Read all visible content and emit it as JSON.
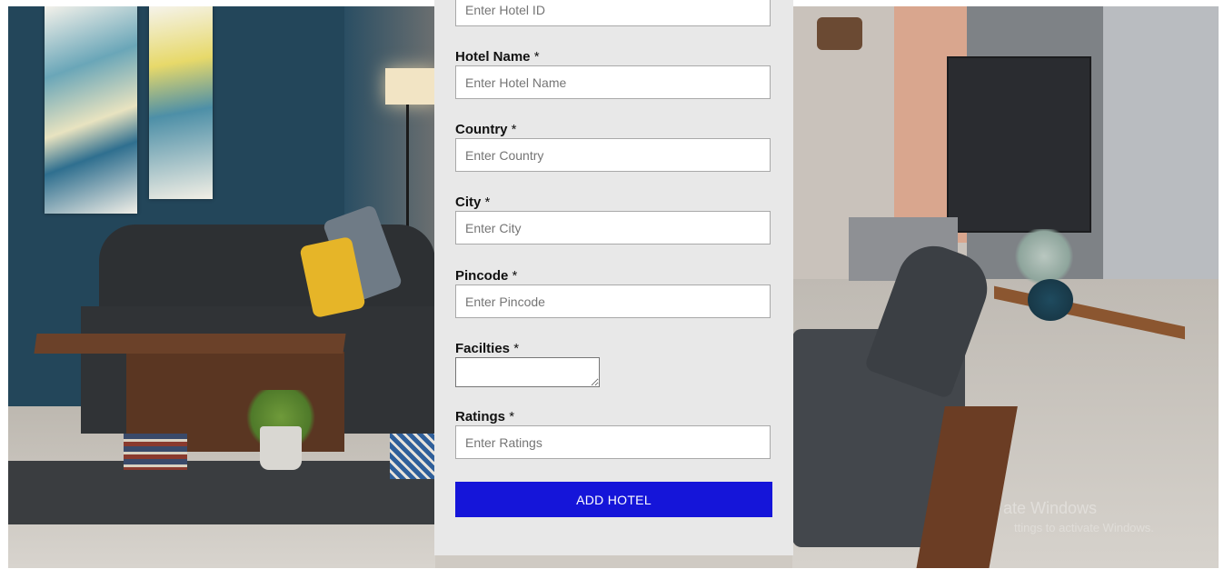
{
  "form": {
    "hotel_id": {
      "placeholder": "Enter Hotel ID"
    },
    "hotel_name": {
      "label": "Hotel Name",
      "required_mark": "*",
      "placeholder": "Enter Hotel Name"
    },
    "country": {
      "label": "Country",
      "required_mark": "*",
      "placeholder": "Enter Country"
    },
    "city": {
      "label": "City",
      "required_mark": "*",
      "placeholder": "Enter City"
    },
    "pincode": {
      "label": "Pincode",
      "required_mark": "*",
      "placeholder": "Enter Pincode"
    },
    "facilities": {
      "label": "Facilties",
      "required_mark": "*",
      "value": ""
    },
    "ratings": {
      "label": "Ratings",
      "required_mark": "*",
      "placeholder": "Enter Ratings"
    },
    "submit_label": "ADD HOTEL"
  },
  "watermark": {
    "line1": "ate Windows",
    "line2": "ttings to activate Windows."
  },
  "colors": {
    "button_bg": "#1515d9",
    "panel_bg": "#e8e8e8"
  }
}
